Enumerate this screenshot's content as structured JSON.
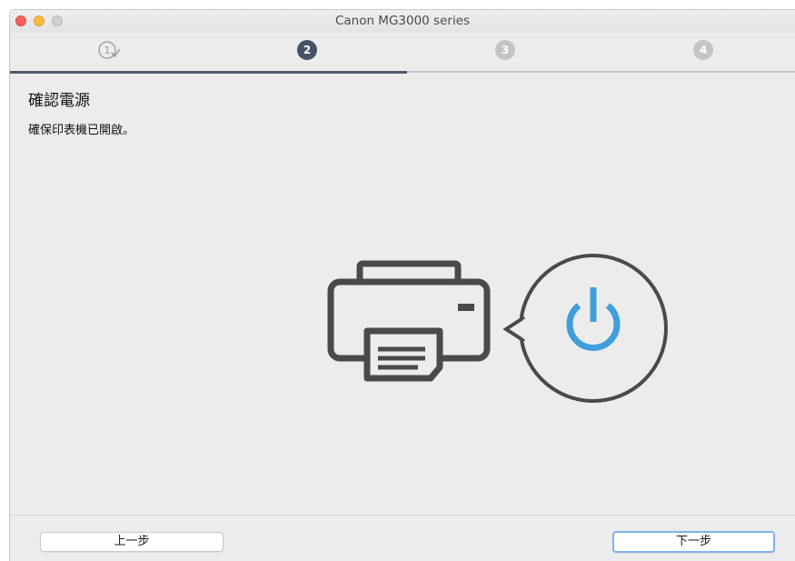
{
  "window": {
    "title": "Canon MG3000 series"
  },
  "steps": {
    "items": [
      {
        "label": "1",
        "state": "completed"
      },
      {
        "label": "2",
        "state": "active"
      },
      {
        "label": "3",
        "state": "inactive"
      },
      {
        "label": "4",
        "state": "inactive"
      }
    ],
    "progress_fraction": 0.5
  },
  "content": {
    "heading": "確認電源",
    "message": "確保印表機已開啟。"
  },
  "illustration": {
    "icons": [
      "printer-icon",
      "power-icon"
    ],
    "power_color": "#3f9fdc",
    "printer_color": "#4a4a4a"
  },
  "buttons": {
    "back_label": "上一步",
    "next_label": "下一步"
  },
  "colors": {
    "active_step": "#465266",
    "inactive_step": "#c4c4c4",
    "focus_ring": "#7fb3ee"
  }
}
